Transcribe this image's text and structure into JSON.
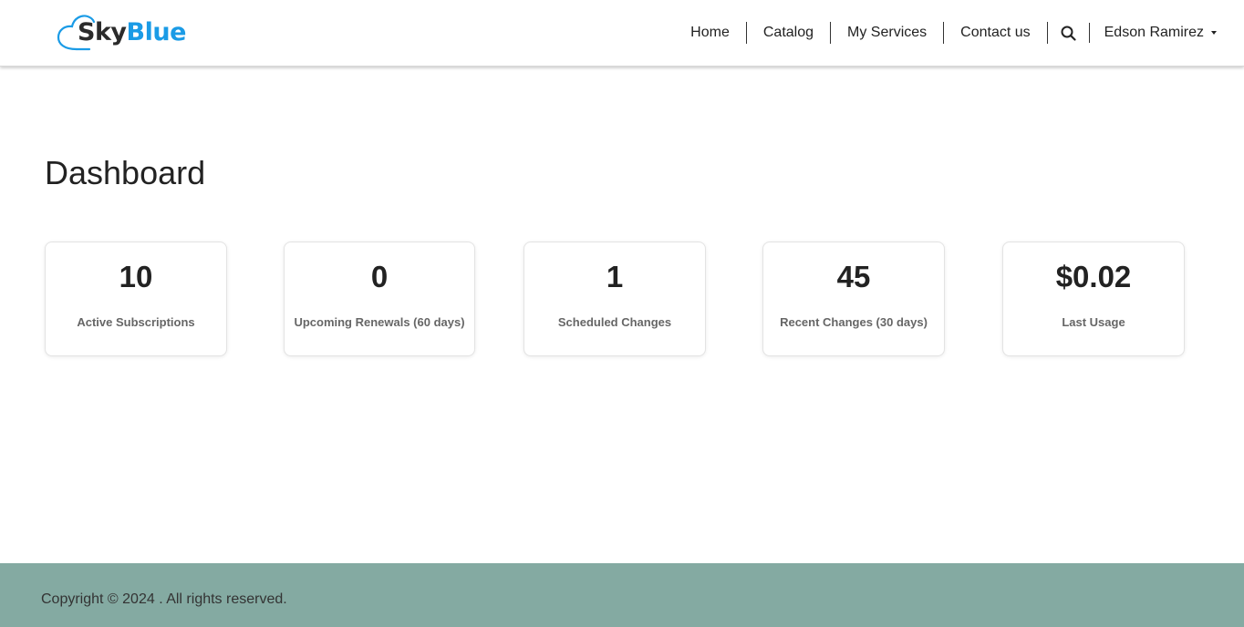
{
  "header": {
    "logo": {
      "part1": "Sky",
      "part2": "Blue"
    },
    "nav": [
      {
        "label": "Home"
      },
      {
        "label": "Catalog"
      },
      {
        "label": "My Services"
      },
      {
        "label": "Contact us"
      }
    ],
    "search_icon": "search-icon",
    "user": {
      "name": "Edson Ramirez",
      "icon": "chevron-down-icon"
    }
  },
  "main": {
    "title": "Dashboard",
    "cards": [
      {
        "value": "10",
        "label": "Active Subscriptions"
      },
      {
        "value": "0",
        "label": "Upcoming Renewals (60 days)"
      },
      {
        "value": "1",
        "label": "Scheduled Changes"
      },
      {
        "value": "45",
        "label": "Recent Changes (30 days)"
      },
      {
        "value": "$0.02",
        "label": "Last Usage"
      }
    ]
  },
  "footer": {
    "copyright": "Copyright © 2024 . All rights reserved."
  },
  "colors": {
    "brand_blue": "#1a9be6",
    "footer_bg": "#84aaa2"
  }
}
